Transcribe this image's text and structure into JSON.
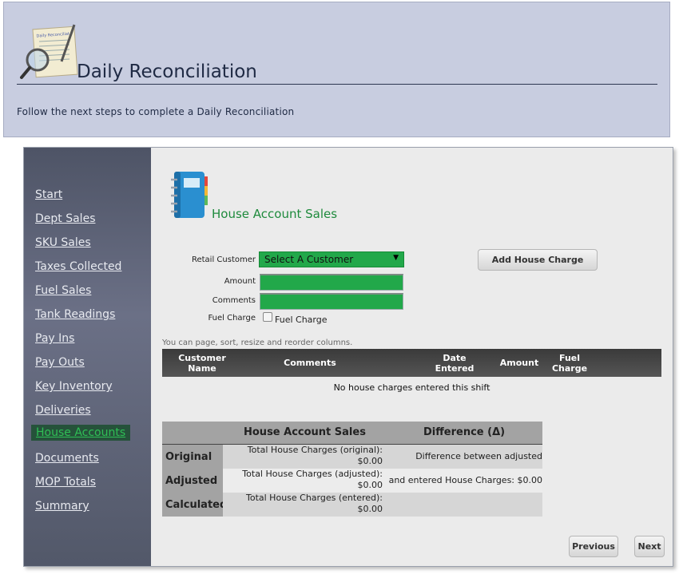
{
  "header": {
    "title": "Daily Reconciliation",
    "subtitle": "Follow the next steps to complete a Daily Reconciliation",
    "icon": "magnifier-document-icon"
  },
  "sidebar": {
    "items": [
      {
        "label": "Start"
      },
      {
        "label": "Dept Sales"
      },
      {
        "label": "SKU Sales"
      },
      {
        "label": "Taxes Collected"
      },
      {
        "label": "Fuel Sales"
      },
      {
        "label": "Tank Readings"
      },
      {
        "label": "Pay Ins"
      },
      {
        "label": "Pay Outs"
      },
      {
        "label": "Key Inventory"
      },
      {
        "label": "Deliveries"
      },
      {
        "label": "House Accounts",
        "active": true
      },
      {
        "label": "Documents"
      },
      {
        "label": "MOP Totals"
      },
      {
        "label": "Summary"
      }
    ]
  },
  "main": {
    "title": "House Account Sales",
    "icon": "notebook-icon",
    "form": {
      "customer_label": "Retail Customer",
      "customer_value": "Select A Customer",
      "amount_label": "Amount",
      "amount_value": "",
      "comments_label": "Comments",
      "comments_value": "",
      "fuel_label": "Fuel Charge",
      "fuel_checkbox_label": "Fuel Charge",
      "add_button": "Add House Charge"
    },
    "grid": {
      "hint": "You can page, sort, resize and reorder columns.",
      "columns": [
        "Customer Name",
        "Comments",
        "Date Entered",
        "Amount",
        "Fuel Charge"
      ],
      "empty": "No house charges entered this shift"
    },
    "summary": {
      "headers": [
        "House Account Sales",
        "Difference (Δ)"
      ],
      "rows": [
        {
          "label": "Original",
          "value": "Total House Charges (original): $0.00",
          "diff": "Difference between adjusted"
        },
        {
          "label": "Adjusted",
          "value": "Total House Charges (adjusted): $0.00",
          "diff": "and entered House Charges: $0.00"
        },
        {
          "label": "Calculated",
          "value": "Total House Charges (entered): $0.00",
          "diff": ""
        }
      ]
    },
    "nav": {
      "previous": "Previous",
      "next": "Next"
    }
  },
  "colors": {
    "accent_green": "#22a84a",
    "title_green": "#1e8a3c",
    "header_bg": "#c8cde0",
    "sidebar_bg": "#5c6176"
  }
}
